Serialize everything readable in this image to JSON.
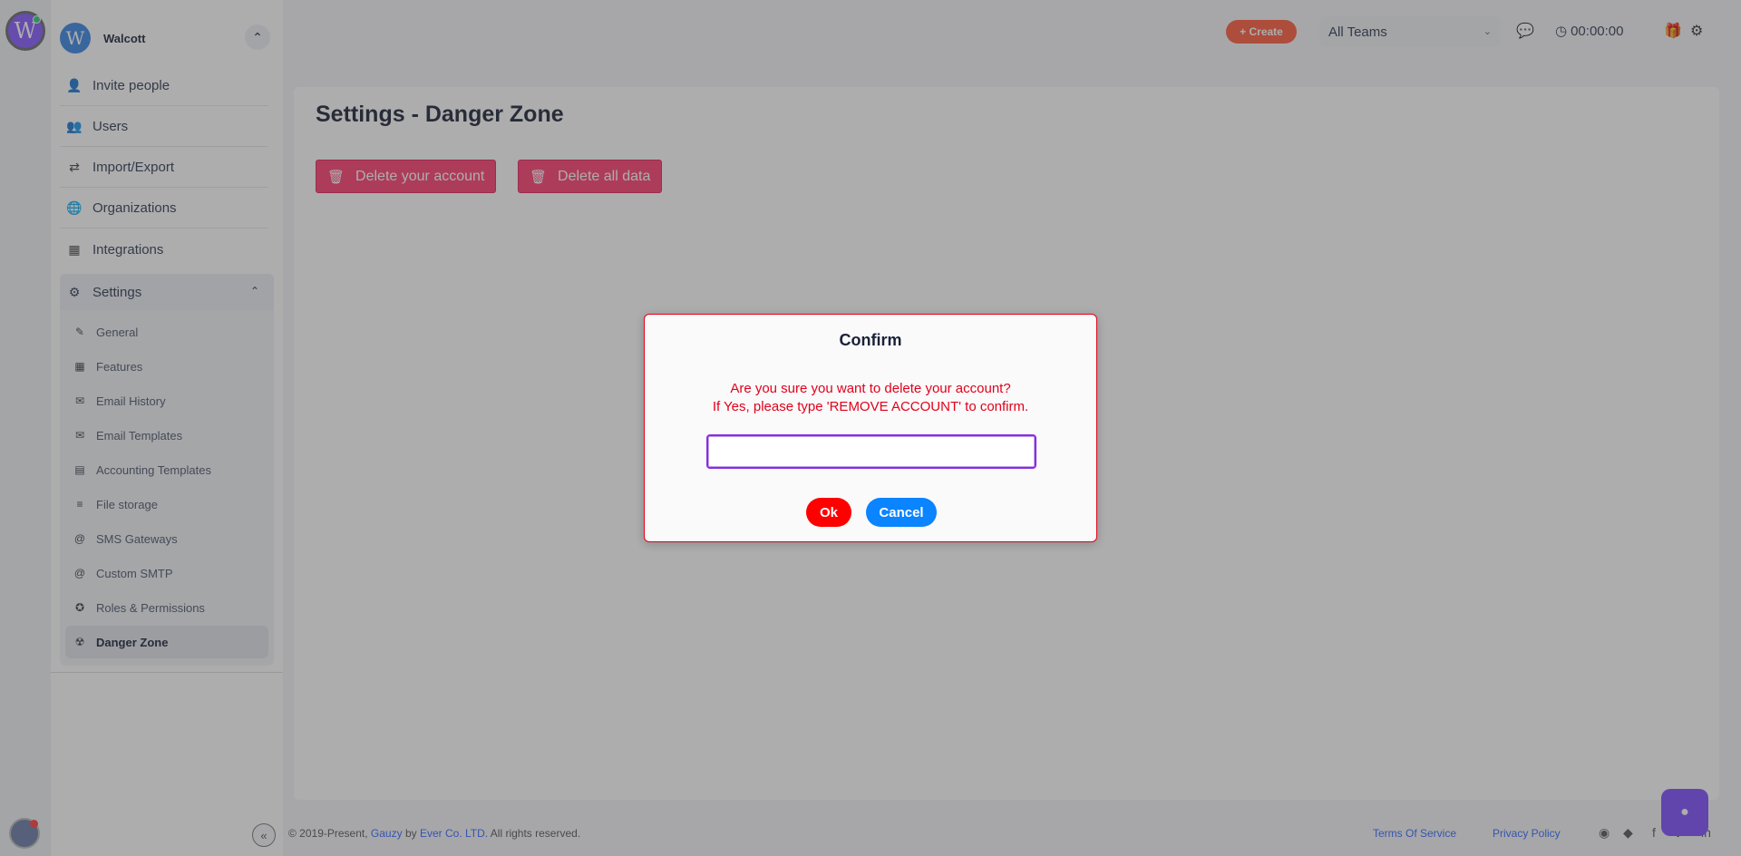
{
  "user": {
    "avatar_letter": "W"
  },
  "org": {
    "avatar_letter": "W",
    "name": "Walcott",
    "toggle_icon": "chevron-up-icon"
  },
  "menu": [
    {
      "label": "Invite people",
      "icon": "user-plus-icon"
    },
    {
      "label": "Users",
      "icon": "users-icon"
    },
    {
      "label": "Import/Export",
      "icon": "exchange-icon"
    },
    {
      "label": "Organizations",
      "icon": "globe-icon"
    },
    {
      "label": "Integrations",
      "icon": "puzzle-icon"
    }
  ],
  "settings": {
    "label": "Settings",
    "items": [
      {
        "label": "General",
        "icon": "pencil-icon"
      },
      {
        "label": "Features",
        "icon": "puzzle-icon"
      },
      {
        "label": "Email History",
        "icon": "envelope-open-icon"
      },
      {
        "label": "Email Templates",
        "icon": "envelope-icon"
      },
      {
        "label": "Accounting Templates",
        "icon": "id-card-icon"
      },
      {
        "label": "File storage",
        "icon": "database-icon"
      },
      {
        "label": "SMS Gateways",
        "icon": "at-icon"
      },
      {
        "label": "Custom SMTP",
        "icon": "at-icon"
      },
      {
        "label": "Roles & Permissions",
        "icon": "award-icon"
      },
      {
        "label": "Danger Zone",
        "icon": "radiation-icon",
        "active": true
      }
    ]
  },
  "header": {
    "create_label": "+ Create",
    "teams_value": "All Teams",
    "timer": "00:00:00"
  },
  "page": {
    "title": "Settings - Danger Zone",
    "delete_account_label": "Delete your account",
    "delete_data_label": "Delete all data"
  },
  "footer": {
    "prefix": "© 2019-Present,",
    "gauzy": "Gauzy",
    "by": "by",
    "company": "Ever Co. LTD.",
    "rights": "All rights reserved.",
    "terms": "Terms Of Service",
    "privacy": "Privacy Policy"
  },
  "dialog": {
    "title": "Confirm",
    "line1": "Are you sure you want to delete your account?",
    "line2": "If Yes, please type 'REMOVE ACCOUNT' to confirm.",
    "input_value": "",
    "ok_label": "Ok",
    "cancel_label": "Cancel"
  },
  "colors": {
    "danger": "#ff3d71",
    "ok": "#ff0000",
    "cancel": "#0a84ff",
    "create": "#ff5a3c",
    "chat": "#7c4dff"
  }
}
